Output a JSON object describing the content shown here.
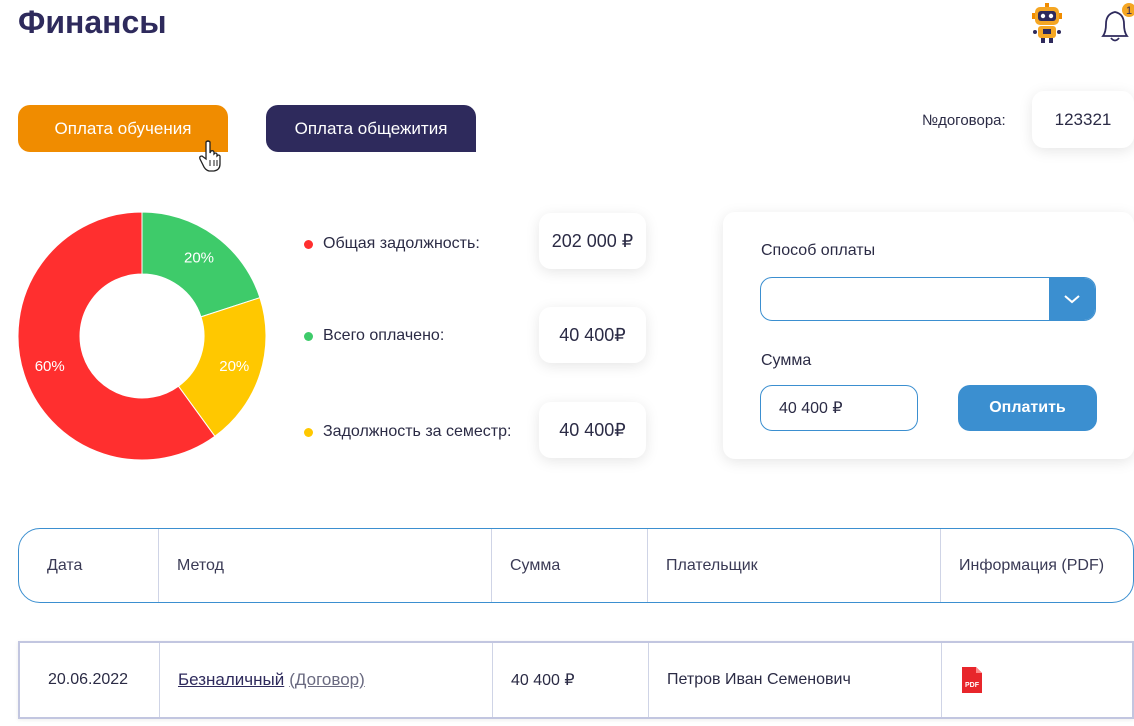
{
  "header": {
    "title": "Финансы",
    "robot_icon": "robot-assistant-icon",
    "bell_icon": "bell-icon",
    "notification_count": "1"
  },
  "tabs": [
    {
      "label": "Оплата обучения",
      "active": true,
      "color": "#f08c00"
    },
    {
      "label": "Оплата общежития",
      "active": false,
      "color": "#2e2a5c"
    }
  ],
  "contract": {
    "label": "№договора:",
    "number": "123321"
  },
  "chart_data": {
    "type": "pie",
    "variant": "donut",
    "slices": [
      {
        "label": "20%",
        "value": 20,
        "color": "#3ecb6a"
      },
      {
        "label": "20%",
        "value": 20,
        "color": "#ffc800"
      },
      {
        "label": "60%",
        "value": 60,
        "color": "#ff2f2f"
      }
    ]
  },
  "summary": [
    {
      "label": "Общая задолжность:",
      "value": "202 000 ₽",
      "color": "#ff2f2f"
    },
    {
      "label": "Всего оплачено:",
      "value": "40 400₽",
      "color": "#3ecb6a"
    },
    {
      "label": "Задолжность за семестр:",
      "value": "40 400₽",
      "color": "#ffc800"
    }
  ],
  "payment": {
    "method_label": "Способ оплаты",
    "method_value": "",
    "amount_label": "Сумма",
    "amount_value": "40 400 ₽",
    "pay_button": "Оплатить"
  },
  "table": {
    "headers": [
      "Дата",
      "Метод",
      "Сумма",
      "Плательщик",
      "Информация (PDF)"
    ],
    "rows": [
      {
        "date": "20.06.2022",
        "method_main": "Безналичный",
        "method_sub": "(Договор)",
        "amount": "40 400 ₽",
        "payer": "Петров Иван Семенович",
        "pdf_icon": "pdf-file-icon",
        "pdf_text": "PDF"
      }
    ]
  },
  "colors": {
    "accent_orange": "#f08c00",
    "dark_navy": "#2e2a5c",
    "blue": "#3b8fd0"
  }
}
